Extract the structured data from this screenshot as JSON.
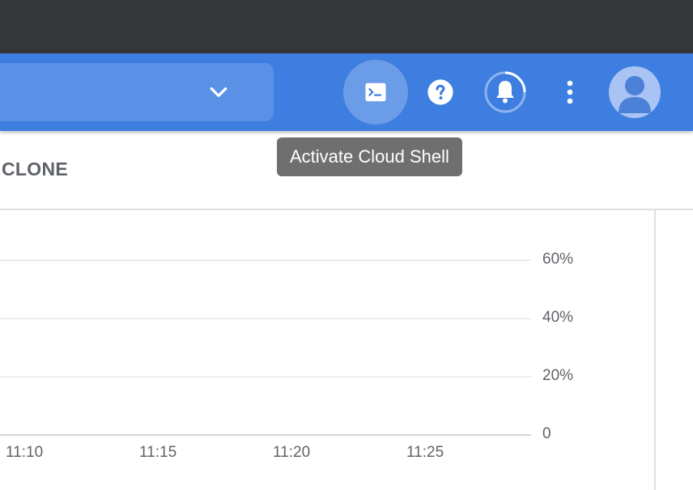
{
  "header": {
    "colors": {
      "bar": "#3e7ee0",
      "top_strip": "#35363a"
    },
    "search": {
      "chevron_icon": "chevron-down-icon"
    },
    "actions": {
      "shell_icon": "cloud-shell-icon",
      "help_icon": "help-icon",
      "notifications_icon": "bell-icon",
      "more_icon": "more-vert-icon",
      "avatar_icon": "avatar-icon"
    }
  },
  "tooltip": {
    "text": "Activate Cloud Shell"
  },
  "tabs": {
    "clone_label": "CLONE"
  },
  "chart_data": {
    "type": "line",
    "x_ticks": [
      "11:10",
      "11:15",
      "11:20",
      "11:25"
    ],
    "y_ticks": [
      "60%",
      "40%",
      "20%",
      "0"
    ],
    "y_range": [
      0,
      60
    ],
    "grid": true,
    "series": []
  }
}
